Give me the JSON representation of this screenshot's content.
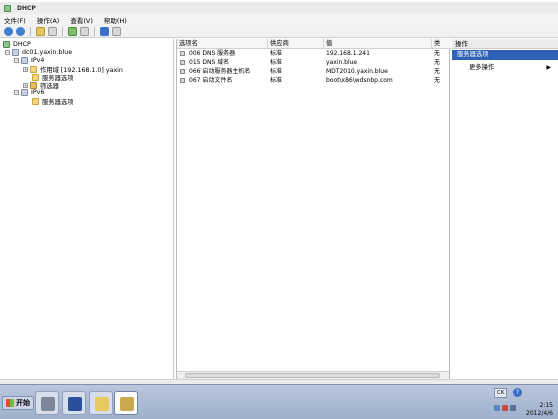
{
  "window": {
    "title": "DHCP"
  },
  "menu": {
    "items": [
      "文件(F)",
      "操作(A)",
      "查看(V)",
      "帮助(H)"
    ]
  },
  "toolbar": {
    "icons": [
      "back-icon",
      "forward-icon",
      "up-icon",
      "show-tree-icon",
      "refresh-icon",
      "export-icon",
      "help-icon",
      "properties-icon"
    ]
  },
  "tree": {
    "root": "DHCP",
    "server": "dc01.yaxin.blue",
    "ipv4": "IPv4",
    "scope": "作用域 [192.168.1.0] yaxin",
    "server_options_v4": "服务器选项",
    "filters": "筛选器",
    "ipv6": "IPv6",
    "server_options_v6": "服务器选项"
  },
  "list": {
    "columns": [
      "选项名",
      "供应商",
      "值",
      "类"
    ],
    "rows": [
      {
        "name": "006 DNS 服务器",
        "vendor": "标准",
        "value": "192.168.1.241",
        "class": "无"
      },
      {
        "name": "015 DNS 域名",
        "vendor": "标准",
        "value": "yaxin.blue",
        "class": "无"
      },
      {
        "name": "066 启动服务器主机名",
        "vendor": "标准",
        "value": "MDT2010.yaxin.blue",
        "class": "无"
      },
      {
        "name": "067 启动文件名",
        "vendor": "标准",
        "value": "boot\\x86\\wdsnbp.com",
        "class": "无"
      }
    ]
  },
  "actions": {
    "header": "操作",
    "selected": "服务器选项",
    "more": "更多操作",
    "more_arrow": "▶"
  },
  "taskbar": {
    "start": "开始",
    "ck": "CK",
    "help": "?",
    "time": "2:15",
    "date": "2012/4/6",
    "colors": {
      "accent": "#2f61b7"
    }
  }
}
